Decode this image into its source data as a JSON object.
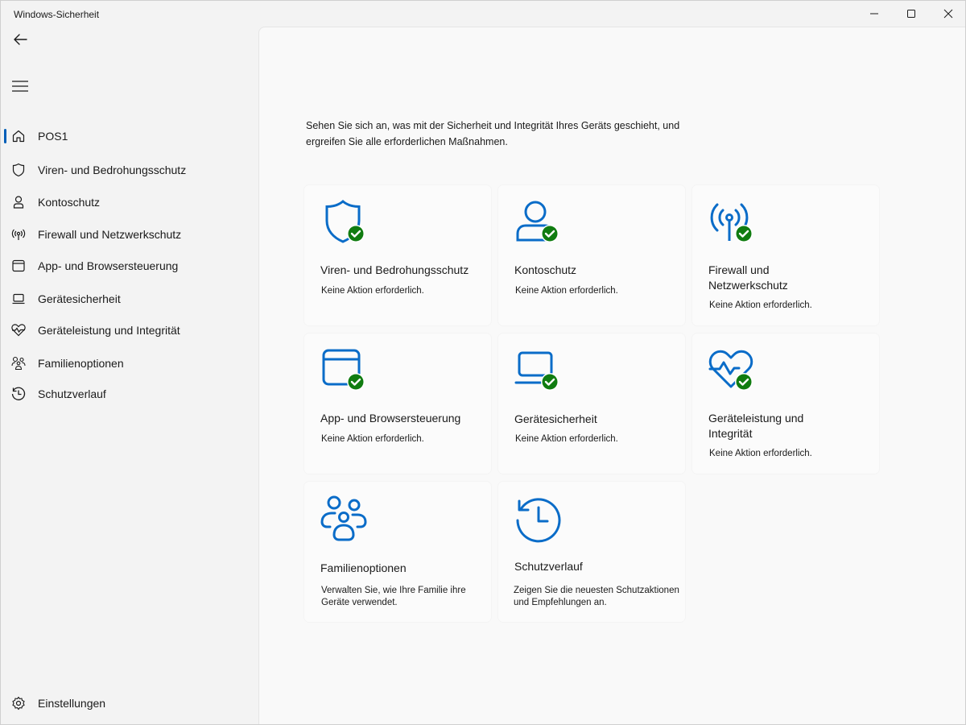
{
  "window": {
    "title": "Windows-Sicherheit"
  },
  "colors": {
    "accent": "#005fb8",
    "icon_blue": "#0a6cc8",
    "check_green": "#107c10"
  },
  "sidebar": {
    "items": [
      {
        "label": "POS1",
        "icon": "home-icon",
        "selected": true
      },
      {
        "label": "Viren- und Bedrohungsschutz",
        "icon": "shield-icon"
      },
      {
        "label": "Kontoschutz",
        "icon": "person-icon"
      },
      {
        "label": "Firewall und Netzwerkschutz",
        "icon": "antenna-icon"
      },
      {
        "label": "App- und Browsersteuerung",
        "icon": "browser-window-icon"
      },
      {
        "label": "Gerätesicherheit",
        "icon": "laptop-icon"
      },
      {
        "label": "Geräteleistung und Integrität",
        "icon": "heart-pulse-icon"
      },
      {
        "label": "Familienoptionen",
        "icon": "family-icon"
      },
      {
        "label": "Schutzverlauf",
        "icon": "history-icon"
      }
    ],
    "settings": {
      "label": "Einstellungen",
      "icon": "gear-icon"
    }
  },
  "main": {
    "intro": "Sehen Sie sich an, was mit der Sicherheit und Integrität Ihres Geräts geschieht, und ergreifen Sie alle erforderlichen Maßnahmen.",
    "intro_line1": "Sehen Sie sich an, was mit der Sicherheit und Integrität Ihres Geräts geschieht, und",
    "intro_line2": "ergreifen Sie alle erforderlichen Maßnahmen.",
    "cards": [
      {
        "title": "Viren- und Bedrohungsschutz",
        "desc": "Keine Aktion erforderlich.",
        "icon": "shield-check-icon",
        "status": "ok"
      },
      {
        "title": "Kontoschutz",
        "desc": "Keine Aktion erforderlich.",
        "icon": "person-check-icon",
        "status": "ok"
      },
      {
        "title": "Firewall und Netzwerkschutz",
        "desc": "Keine Aktion erforderlich.",
        "icon": "antenna-check-icon",
        "status": "ok"
      },
      {
        "title": "App- und Browsersteuerung",
        "desc": "Keine Aktion erforderlich.",
        "icon": "browser-check-icon",
        "status": "ok"
      },
      {
        "title": "Gerätesicherheit",
        "desc": "Keine Aktion erforderlich.",
        "icon": "laptop-check-icon",
        "status": "ok"
      },
      {
        "title": "Geräteleistung und Integrität",
        "desc": "Keine Aktion erforderlich.",
        "icon": "heart-check-icon",
        "status": "ok"
      },
      {
        "title": "Familienoptionen",
        "desc": "Verwalten Sie, wie Ihre Familie ihre Geräte verwendet.",
        "icon": "family-icon",
        "status": "info"
      },
      {
        "title": "Schutzverlauf",
        "desc": "Zeigen Sie die neuesten Schutzaktionen und Empfehlungen an.",
        "icon": "history-icon",
        "status": "info"
      }
    ]
  }
}
